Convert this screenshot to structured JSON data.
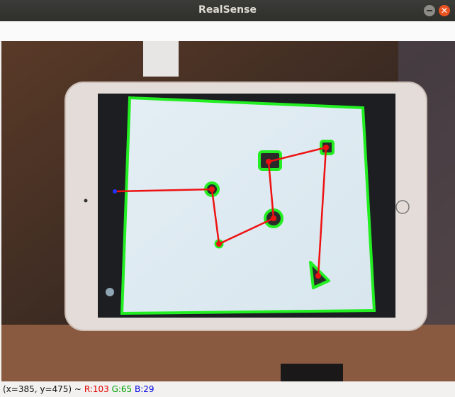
{
  "window": {
    "title": "RealSense"
  },
  "status": {
    "coords": "(x=385, y=475) ~",
    "r": "R:103",
    "g": "G:65",
    "b": "B:29"
  },
  "colors": {
    "detection_outline": "#22ee22",
    "path_line": "#ee1111",
    "start_marker": "#2233ff"
  },
  "icons": [
    "minimize-icon",
    "close-icon"
  ]
}
